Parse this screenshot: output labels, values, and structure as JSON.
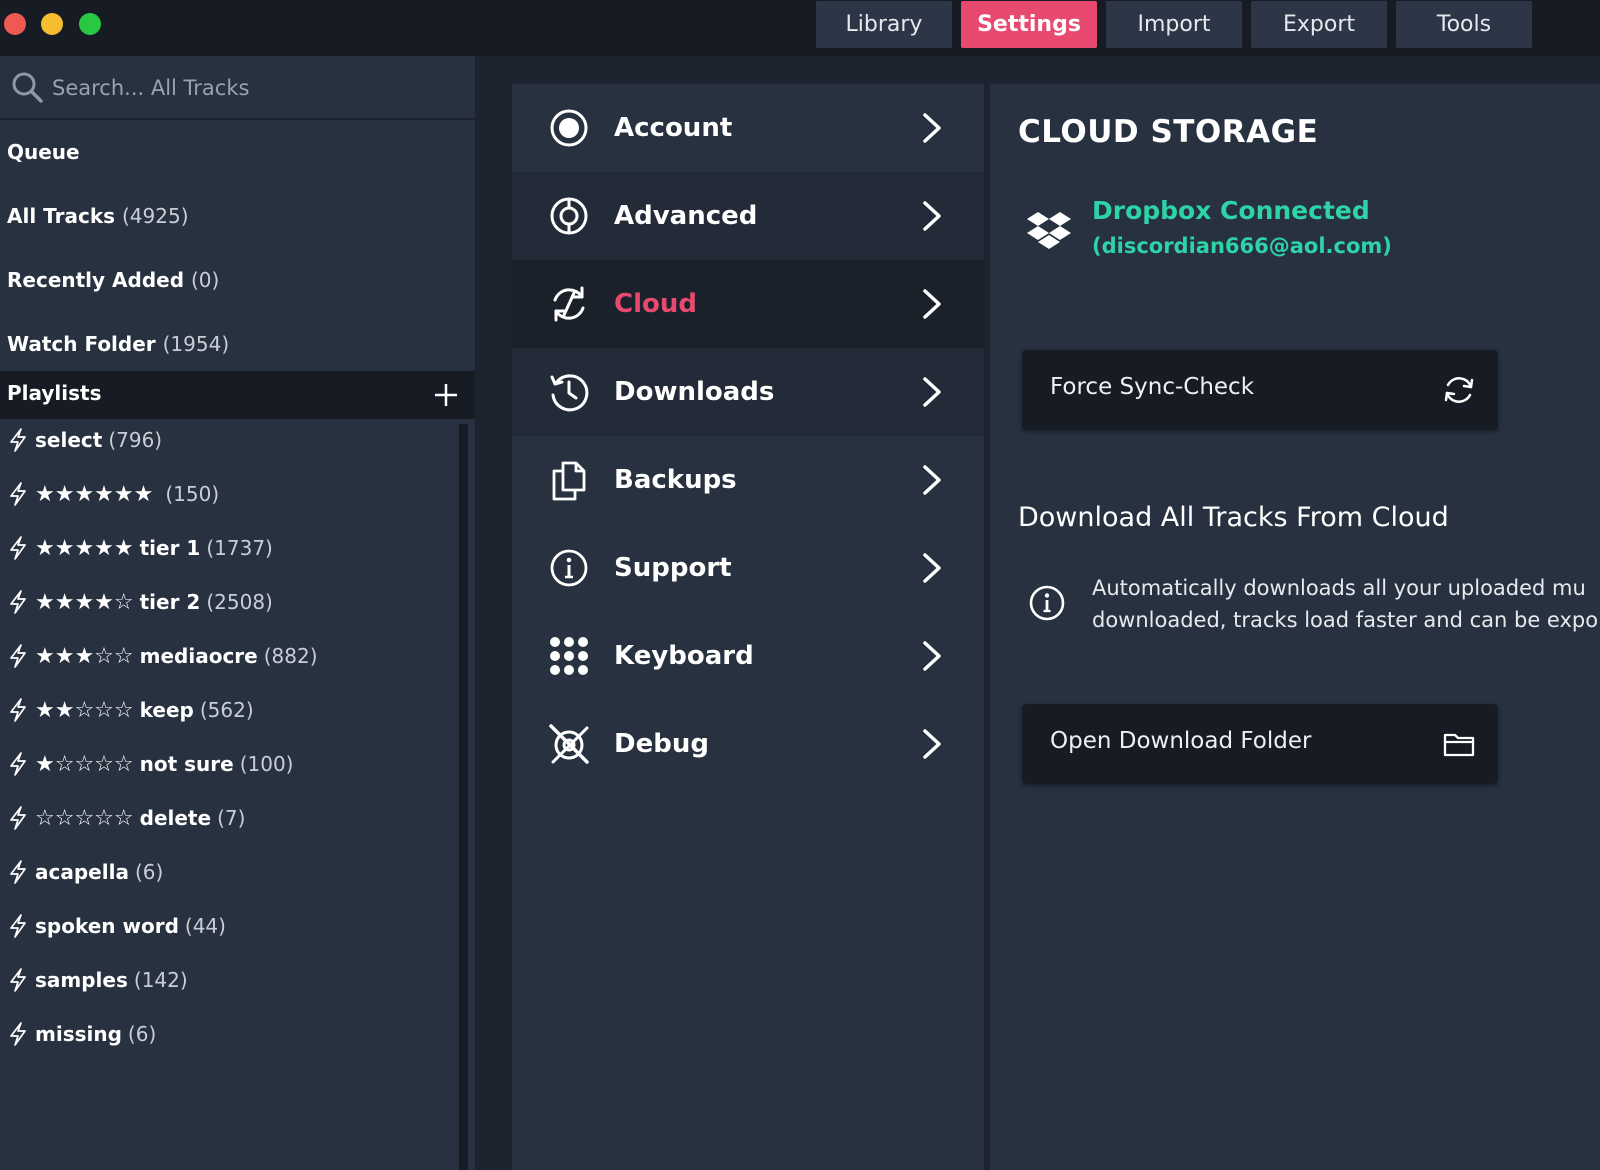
{
  "top_tabs": [
    {
      "label": "Library"
    },
    {
      "label": "Settings"
    },
    {
      "label": "Import"
    },
    {
      "label": "Export"
    },
    {
      "label": "Tools"
    }
  ],
  "search": {
    "placeholder": "Search... All Tracks"
  },
  "library": [
    {
      "label": "Queue",
      "count": ""
    },
    {
      "label": "All Tracks",
      "count": "(4925)"
    },
    {
      "label": "Recently Added",
      "count": "(0)"
    },
    {
      "label": "Watch Folder",
      "count": "(1954)"
    }
  ],
  "playlists": {
    "title": "Playlists",
    "items": [
      {
        "stars": "",
        "name": "select",
        "count": "(796)"
      },
      {
        "stars": "★★★★★★",
        "name": "",
        "count": "(150)"
      },
      {
        "stars": "★★★★★",
        "name": "tier 1",
        "count": "(1737)"
      },
      {
        "stars": "★★★★☆",
        "name": "tier 2",
        "count": "(2508)"
      },
      {
        "stars": "★★★☆☆",
        "name": "mediaocre",
        "count": "(882)"
      },
      {
        "stars": "★★☆☆☆",
        "name": "keep",
        "count": "(562)"
      },
      {
        "stars": "★☆☆☆☆",
        "name": "not sure",
        "count": "(100)"
      },
      {
        "stars": "☆☆☆☆☆",
        "name": "delete",
        "count": "(7)"
      },
      {
        "stars": "",
        "name": "acapella",
        "count": "(6)"
      },
      {
        "stars": "",
        "name": "spoken word",
        "count": "(44)"
      },
      {
        "stars": "",
        "name": "samples",
        "count": "(142)"
      },
      {
        "stars": "",
        "name": "missing",
        "count": "(6)"
      }
    ]
  },
  "settings_nav": [
    {
      "label": "Account",
      "icon": "account-icon"
    },
    {
      "label": "Advanced",
      "icon": "advanced-icon"
    },
    {
      "label": "Cloud",
      "icon": "cloud-sync-icon"
    },
    {
      "label": "Downloads",
      "icon": "downloads-icon"
    },
    {
      "label": "Backups",
      "icon": "backups-icon"
    },
    {
      "label": "Support",
      "icon": "support-info-icon"
    },
    {
      "label": "Keyboard",
      "icon": "keyboard-icon"
    },
    {
      "label": "Debug",
      "icon": "debug-icon"
    }
  ],
  "panel": {
    "title": "CLOUD STORAGE",
    "dropbox_status": "Dropbox Connected",
    "dropbox_email": "(discordian666@aol.com)",
    "force_sync_label": "Force Sync-Check",
    "download_heading": "Download All Tracks From Cloud",
    "info_line1": "Automatically downloads all your uploaded mu",
    "info_line2": "downloaded, tracks load faster and can be expo",
    "open_folder_label": "Open Download Folder"
  },
  "colors": {
    "accent": "#e84a6f",
    "connected": "#2ed3a8",
    "panel_bg": "#27313f",
    "dark_bg": "#161b24"
  }
}
